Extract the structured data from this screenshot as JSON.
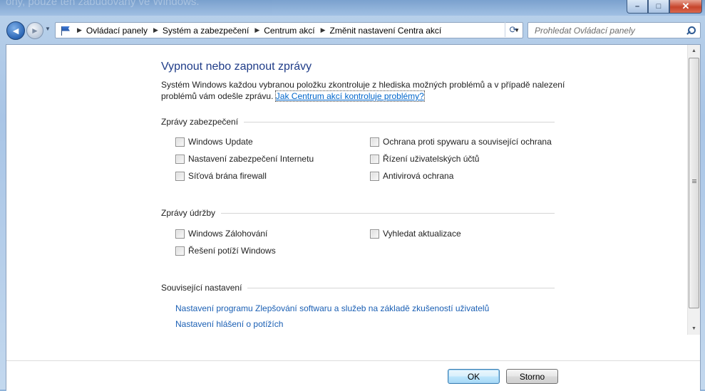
{
  "window": {
    "background_text": "ony, pouze ten zabudovaný ve Windows.",
    "caption": {
      "minimize": "–",
      "maximize": "□",
      "close": "✕"
    }
  },
  "nav": {
    "back_glyph": "◄",
    "forward_glyph": "►",
    "breadcrumb": [
      "Ovládací panely",
      "Systém a zabezpečení",
      "Centrum akcí",
      "Změnit nastavení Centra akcí"
    ],
    "refresh_glyph": "⟳",
    "search_placeholder": "Prohledat Ovládací panely"
  },
  "page": {
    "title": "Vypnout nebo zapnout zprávy",
    "description": "Systém Windows každou vybranou položku zkontroluje z hlediska možných problémů a v případě nalezení problémů vám odešle zprávu.",
    "help_link": "Jak Centrum akcí kontroluje problémy?"
  },
  "security": {
    "heading": "Zprávy zabezpečení",
    "items": [
      {
        "label": "Windows Update",
        "checked": false
      },
      {
        "label": "Ochrana proti spywaru a související ochrana",
        "checked": false
      },
      {
        "label": "Nastavení zabezpečení Internetu",
        "checked": false
      },
      {
        "label": "Řízení uživatelských účtů",
        "checked": false
      },
      {
        "label": "Síťová brána firewall",
        "checked": false
      },
      {
        "label": "Antivirová ochrana",
        "checked": false
      }
    ]
  },
  "maintenance": {
    "heading": "Zprávy údržby",
    "items": [
      {
        "label": "Windows Zálohování",
        "checked": false
      },
      {
        "label": "Vyhledat aktualizace",
        "checked": false
      },
      {
        "label": "Řešení potíží Windows",
        "checked": false
      }
    ]
  },
  "related": {
    "heading": "Související nastavení",
    "links": [
      "Nastavení programu Zlepšování softwaru a služeb na základě zkušeností uživatelů",
      "Nastavení hlášení o potížích"
    ]
  },
  "buttons": {
    "ok": "OK",
    "cancel": "Storno"
  },
  "colors": {
    "title": "#1f3c88",
    "link": "#1a5fb4",
    "chrome": "#b9d1ea"
  }
}
